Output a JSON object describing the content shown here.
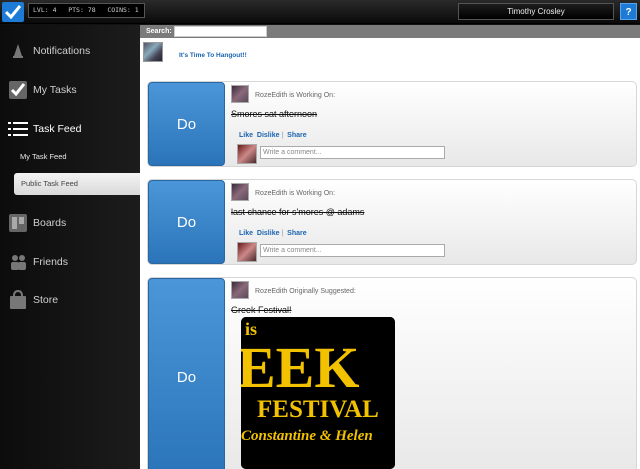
{
  "topbar": {
    "stats": "LVL: 4   PTS: 78   COINS: 1",
    "username": "Timothy Crosley",
    "help_label": "?"
  },
  "sidebar": {
    "notifications": "Notifications",
    "my_tasks": "My Tasks",
    "task_feed": "Task Feed",
    "my_task_feed": "My Task Feed",
    "public_task_feed": "Public Task Feed",
    "boards": "Boards",
    "friends": "Friends",
    "store": "Store"
  },
  "search": {
    "label": "Search:",
    "value": ""
  },
  "hangout": {
    "text": "It's Time To Hangout!!"
  },
  "feed": [
    {
      "do_label": "Do",
      "meta": "RozeEdith is Working On:",
      "title": "Smores sat afternoon",
      "like": "Like",
      "dislike": "Dislike",
      "share": "Share",
      "comment_placeholder": "Write a comment..."
    },
    {
      "do_label": "Do",
      "meta": "RozeEdith is Working On:",
      "title": "last chance for s'mores @ adams",
      "like": "Like",
      "dislike": "Dislike",
      "share": "Share",
      "comment_placeholder": "Write a comment..."
    },
    {
      "do_label": "Do",
      "meta": "RozeEdith Originally Suggested:",
      "title": "Greek Festival!",
      "poster": {
        "line1": "is",
        "line2": "EEK",
        "line3": "FESTIVAL",
        "line4": "Constantine & Helen"
      }
    }
  ],
  "colors": {
    "accent_blue": "#2b7bc4",
    "link_blue": "#1a64b0",
    "poster_gold": "#f2c200"
  }
}
